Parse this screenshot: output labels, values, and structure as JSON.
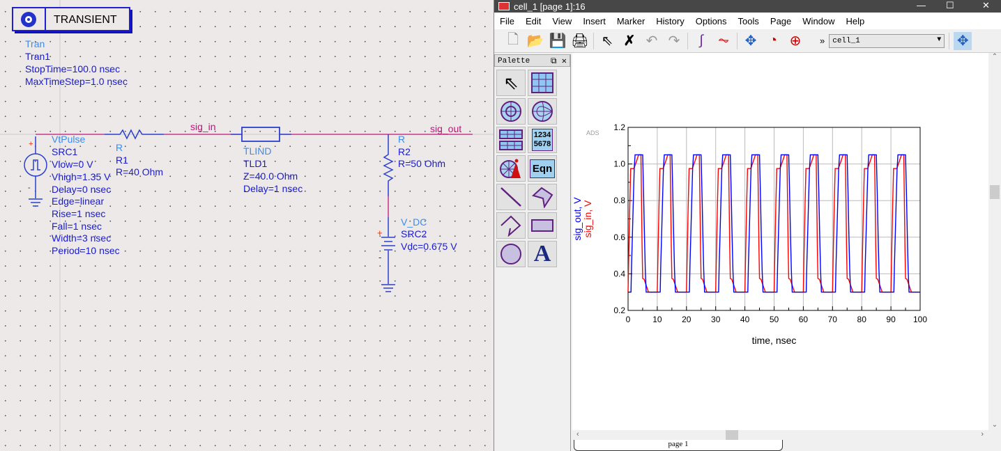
{
  "schematic": {
    "controller": {
      "title": "TRANSIENT",
      "type": "Tran",
      "name": "Tran1",
      "params": [
        "StopTime=100.0 nsec",
        "MaxTimeStep=1.0 nsec"
      ]
    },
    "src1": {
      "type": "VtPulse",
      "name": "SRC1",
      "params": [
        "Vlow=0 V",
        "Vhigh=1.35 V",
        "Delay=0 nsec",
        "Edge=linear",
        "Rise=1 nsec",
        "Fall=1 nsec",
        "Width=3 nsec",
        "Period=10 nsec"
      ]
    },
    "r1": {
      "type": "R",
      "name": "R1",
      "params": [
        "R=40 Ohm"
      ]
    },
    "tld1": {
      "type": "TLIND",
      "name": "TLD1",
      "params": [
        "Z=40.0 Ohm",
        "Delay=1 nsec"
      ]
    },
    "r2": {
      "type": "R",
      "name": "R2",
      "params": [
        "R=50 Ohm"
      ]
    },
    "src2": {
      "type": "V_DC",
      "name": "SRC2",
      "params": [
        "Vdc=0.675 V"
      ]
    },
    "nets": {
      "in": "sig_in",
      "out": "sig_out"
    },
    "colors": {
      "wire": "#c0157a",
      "component": "#2b3fcf",
      "label_type": "#3a8cf0",
      "label_text": "#1a1ad0"
    }
  },
  "window": {
    "title": "cell_1 [page 1]:16",
    "menu": [
      "File",
      "Edit",
      "View",
      "Insert",
      "Marker",
      "History",
      "Options",
      "Tools",
      "Page",
      "Window",
      "Help"
    ],
    "toolbar": [
      "new-icon",
      "open-icon",
      "save-icon",
      "print-icon",
      "select-icon",
      "delete-icon",
      "undo-icon",
      "redo-icon",
      "trace-icon",
      "plot-icon",
      "pan-icon",
      "zoom-box-icon",
      "zoom-icon"
    ],
    "combo_value": "cell_1",
    "palette": {
      "title": "Palette",
      "items": [
        "select",
        "rectangular-plot",
        "polar-plot",
        "smith-chart",
        "list",
        "stack",
        "antenna",
        "equation",
        "line",
        "polygon",
        "polyline",
        "rectangle",
        "circle",
        "text"
      ],
      "stack_label_1": "1234",
      "stack_label_2": "5678",
      "eqn_label": "Eqn",
      "text_label": "A"
    },
    "page_tab": "page 1",
    "watermark": "ADS"
  },
  "chart_data": {
    "type": "line",
    "xlabel": "time, nsec",
    "ylabels": [
      "sig_out, V",
      "sig_in, V"
    ],
    "xlim": [
      0,
      100
    ],
    "ylim": [
      0.2,
      1.2
    ],
    "xticks": [
      0,
      10,
      20,
      30,
      40,
      50,
      60,
      70,
      80,
      90,
      100
    ],
    "yticks": [
      0.2,
      0.4,
      0.6,
      0.8,
      1.0,
      1.2
    ],
    "grid": true,
    "series": [
      {
        "name": "sig_out",
        "color": "#0000ff",
        "points": [
          [
            0,
            0.3
          ],
          [
            1,
            0.3
          ],
          [
            1.2,
            0.45
          ],
          [
            1.5,
            0.62
          ],
          [
            1.8,
            0.8
          ],
          [
            2.1,
            0.97
          ],
          [
            2.4,
            1.05
          ],
          [
            5,
            1.05
          ],
          [
            5.3,
            0.85
          ],
          [
            5.6,
            0.62
          ],
          [
            5.9,
            0.42
          ],
          [
            6.2,
            0.3
          ],
          [
            11,
            0.3
          ],
          [
            11.2,
            0.45
          ],
          [
            11.5,
            0.62
          ],
          [
            11.8,
            0.8
          ],
          [
            12.1,
            0.97
          ],
          [
            12.4,
            1.05
          ],
          [
            15,
            1.05
          ],
          [
            15.3,
            0.85
          ],
          [
            15.6,
            0.62
          ],
          [
            15.9,
            0.42
          ],
          [
            16.2,
            0.3
          ],
          [
            21,
            0.3
          ],
          [
            21.2,
            0.45
          ],
          [
            21.5,
            0.62
          ],
          [
            21.8,
            0.8
          ],
          [
            22.1,
            0.97
          ],
          [
            22.4,
            1.05
          ],
          [
            25,
            1.05
          ],
          [
            25.3,
            0.85
          ],
          [
            25.6,
            0.62
          ],
          [
            25.9,
            0.42
          ],
          [
            26.2,
            0.3
          ],
          [
            31,
            0.3
          ],
          [
            31.2,
            0.45
          ],
          [
            31.5,
            0.62
          ],
          [
            31.8,
            0.8
          ],
          [
            32.1,
            0.97
          ],
          [
            32.4,
            1.05
          ],
          [
            35,
            1.05
          ],
          [
            35.3,
            0.85
          ],
          [
            35.6,
            0.62
          ],
          [
            35.9,
            0.42
          ],
          [
            36.2,
            0.3
          ],
          [
            41,
            0.3
          ],
          [
            41.2,
            0.45
          ],
          [
            41.5,
            0.62
          ],
          [
            41.8,
            0.8
          ],
          [
            42.1,
            0.97
          ],
          [
            42.4,
            1.05
          ],
          [
            45,
            1.05
          ],
          [
            45.3,
            0.85
          ],
          [
            45.6,
            0.62
          ],
          [
            45.9,
            0.42
          ],
          [
            46.2,
            0.3
          ],
          [
            51,
            0.3
          ],
          [
            51.2,
            0.45
          ],
          [
            51.5,
            0.62
          ],
          [
            51.8,
            0.8
          ],
          [
            52.1,
            0.97
          ],
          [
            52.4,
            1.05
          ],
          [
            55,
            1.05
          ],
          [
            55.3,
            0.85
          ],
          [
            55.6,
            0.62
          ],
          [
            55.9,
            0.42
          ],
          [
            56.2,
            0.3
          ],
          [
            61,
            0.3
          ],
          [
            61.2,
            0.45
          ],
          [
            61.5,
            0.62
          ],
          [
            61.8,
            0.8
          ],
          [
            62.1,
            0.97
          ],
          [
            62.4,
            1.05
          ],
          [
            65,
            1.05
          ],
          [
            65.3,
            0.85
          ],
          [
            65.6,
            0.62
          ],
          [
            65.9,
            0.42
          ],
          [
            66.2,
            0.3
          ],
          [
            71,
            0.3
          ],
          [
            71.2,
            0.45
          ],
          [
            71.5,
            0.62
          ],
          [
            71.8,
            0.8
          ],
          [
            72.1,
            0.97
          ],
          [
            72.4,
            1.05
          ],
          [
            75,
            1.05
          ],
          [
            75.3,
            0.85
          ],
          [
            75.6,
            0.62
          ],
          [
            75.9,
            0.42
          ],
          [
            76.2,
            0.3
          ],
          [
            81,
            0.3
          ],
          [
            81.2,
            0.45
          ],
          [
            81.5,
            0.62
          ],
          [
            81.8,
            0.8
          ],
          [
            82.1,
            0.97
          ],
          [
            82.4,
            1.05
          ],
          [
            85,
            1.05
          ],
          [
            85.3,
            0.85
          ],
          [
            85.6,
            0.62
          ],
          [
            85.9,
            0.42
          ],
          [
            86.2,
            0.3
          ],
          [
            91,
            0.3
          ],
          [
            91.2,
            0.45
          ],
          [
            91.5,
            0.62
          ],
          [
            91.8,
            0.8
          ],
          [
            92.1,
            0.97
          ],
          [
            92.4,
            1.05
          ],
          [
            95,
            1.05
          ],
          [
            95.3,
            0.85
          ],
          [
            95.6,
            0.62
          ],
          [
            95.9,
            0.42
          ],
          [
            96.2,
            0.3
          ],
          [
            100,
            0.3
          ]
        ]
      },
      {
        "name": "sig_in",
        "color": "#ff0000",
        "points": [
          [
            0,
            0.3
          ],
          [
            0.3,
            0.55
          ],
          [
            0.6,
            0.78
          ],
          [
            0.9,
            0.975
          ],
          [
            2,
            0.975
          ],
          [
            3,
            1.02
          ],
          [
            3.6,
            1.05
          ],
          [
            4.4,
            1.05
          ],
          [
            4.6,
            0.8
          ],
          [
            4.8,
            0.55
          ],
          [
            5,
            0.375
          ],
          [
            5.5,
            0.37
          ],
          [
            7,
            0.3
          ],
          [
            10,
            0.3
          ],
          [
            10.3,
            0.55
          ],
          [
            10.6,
            0.78
          ],
          [
            10.9,
            0.975
          ],
          [
            12,
            0.975
          ],
          [
            13,
            1.02
          ],
          [
            13.6,
            1.05
          ],
          [
            14.4,
            1.05
          ],
          [
            14.6,
            0.8
          ],
          [
            14.8,
            0.55
          ],
          [
            15,
            0.375
          ],
          [
            15.5,
            0.37
          ],
          [
            17,
            0.3
          ],
          [
            20,
            0.3
          ],
          [
            20.3,
            0.55
          ],
          [
            20.6,
            0.78
          ],
          [
            20.9,
            0.975
          ],
          [
            22,
            0.975
          ],
          [
            23,
            1.02
          ],
          [
            23.6,
            1.05
          ],
          [
            24.4,
            1.05
          ],
          [
            24.6,
            0.8
          ],
          [
            24.8,
            0.55
          ],
          [
            25,
            0.375
          ],
          [
            25.5,
            0.37
          ],
          [
            27,
            0.3
          ],
          [
            30,
            0.3
          ],
          [
            30.3,
            0.55
          ],
          [
            30.6,
            0.78
          ],
          [
            30.9,
            0.975
          ],
          [
            32,
            0.975
          ],
          [
            33,
            1.02
          ],
          [
            33.6,
            1.05
          ],
          [
            34.4,
            1.05
          ],
          [
            34.6,
            0.8
          ],
          [
            34.8,
            0.55
          ],
          [
            35,
            0.375
          ],
          [
            35.5,
            0.37
          ],
          [
            37,
            0.3
          ],
          [
            40,
            0.3
          ],
          [
            40.3,
            0.55
          ],
          [
            40.6,
            0.78
          ],
          [
            40.9,
            0.975
          ],
          [
            42,
            0.975
          ],
          [
            43,
            1.02
          ],
          [
            43.6,
            1.05
          ],
          [
            44.4,
            1.05
          ],
          [
            44.6,
            0.8
          ],
          [
            44.8,
            0.55
          ],
          [
            45,
            0.375
          ],
          [
            45.5,
            0.37
          ],
          [
            47,
            0.3
          ],
          [
            50,
            0.3
          ],
          [
            50.3,
            0.55
          ],
          [
            50.6,
            0.78
          ],
          [
            50.9,
            0.975
          ],
          [
            52,
            0.975
          ],
          [
            53,
            1.02
          ],
          [
            53.6,
            1.05
          ],
          [
            54.4,
            1.05
          ],
          [
            54.6,
            0.8
          ],
          [
            54.8,
            0.55
          ],
          [
            55,
            0.375
          ],
          [
            55.5,
            0.37
          ],
          [
            57,
            0.3
          ],
          [
            60,
            0.3
          ],
          [
            60.3,
            0.55
          ],
          [
            60.6,
            0.78
          ],
          [
            60.9,
            0.975
          ],
          [
            62,
            0.975
          ],
          [
            63,
            1.02
          ],
          [
            63.6,
            1.05
          ],
          [
            64.4,
            1.05
          ],
          [
            64.6,
            0.8
          ],
          [
            64.8,
            0.55
          ],
          [
            65,
            0.375
          ],
          [
            65.5,
            0.37
          ],
          [
            67,
            0.3
          ],
          [
            70,
            0.3
          ],
          [
            70.3,
            0.55
          ],
          [
            70.6,
            0.78
          ],
          [
            70.9,
            0.975
          ],
          [
            72,
            0.975
          ],
          [
            73,
            1.02
          ],
          [
            73.6,
            1.05
          ],
          [
            74.4,
            1.05
          ],
          [
            74.6,
            0.8
          ],
          [
            74.8,
            0.55
          ],
          [
            75,
            0.375
          ],
          [
            75.5,
            0.37
          ],
          [
            77,
            0.3
          ],
          [
            80,
            0.3
          ],
          [
            80.3,
            0.55
          ],
          [
            80.6,
            0.78
          ],
          [
            80.9,
            0.975
          ],
          [
            82,
            0.975
          ],
          [
            83,
            1.02
          ],
          [
            83.6,
            1.05
          ],
          [
            84.4,
            1.05
          ],
          [
            84.6,
            0.8
          ],
          [
            84.8,
            0.55
          ],
          [
            85,
            0.375
          ],
          [
            85.5,
            0.37
          ],
          [
            87,
            0.3
          ],
          [
            90,
            0.3
          ],
          [
            90.3,
            0.55
          ],
          [
            90.6,
            0.78
          ],
          [
            90.9,
            0.975
          ],
          [
            92,
            0.975
          ],
          [
            93,
            1.02
          ],
          [
            93.6,
            1.05
          ],
          [
            94.4,
            1.05
          ],
          [
            94.6,
            0.8
          ],
          [
            94.8,
            0.55
          ],
          [
            95,
            0.375
          ],
          [
            95.5,
            0.37
          ],
          [
            97,
            0.3
          ],
          [
            100,
            0.3
          ]
        ]
      }
    ]
  }
}
